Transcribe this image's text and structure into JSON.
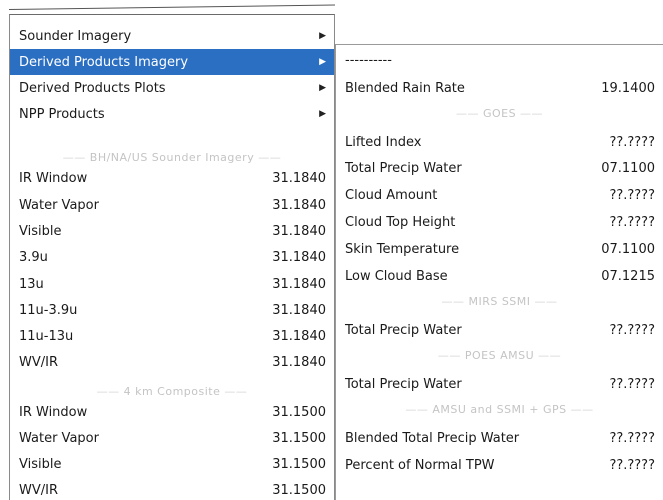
{
  "left_menu": {
    "top_items": [
      {
        "label": "Sounder Imagery"
      },
      {
        "label": "Derived Products Imagery"
      },
      {
        "label": "Derived Products Plots"
      },
      {
        "label": "NPP Products"
      }
    ],
    "separator_1": "BH/NA/US Sounder Imagery",
    "group_1": [
      {
        "label": "IR Window",
        "value": "31.1840"
      },
      {
        "label": "Water Vapor",
        "value": "31.1840"
      },
      {
        "label": "Visible",
        "value": "31.1840"
      },
      {
        "label": "3.9u",
        "value": "31.1840"
      },
      {
        "label": "13u",
        "value": "31.1840"
      },
      {
        "label": "11u-3.9u",
        "value": "31.1840"
      },
      {
        "label": "11u-13u",
        "value": "31.1840"
      },
      {
        "label": "WV/IR",
        "value": "31.1840"
      }
    ],
    "separator_2": "4 km Composite",
    "group_2": [
      {
        "label": "IR Window",
        "value": "31.1500"
      },
      {
        "label": "Water Vapor",
        "value": "31.1500"
      },
      {
        "label": "Visible",
        "value": "31.1500"
      },
      {
        "label": "WV/IR",
        "value": "31.1500"
      }
    ]
  },
  "right_menu": {
    "tearoff": "----------",
    "blended_rain": {
      "label": "Blended Rain Rate",
      "value": "19.1400"
    },
    "separator_goes": "GOES",
    "goes_items": [
      {
        "label": "Lifted Index",
        "value": "??.????"
      },
      {
        "label": "Total Precip Water",
        "value": "07.1100"
      },
      {
        "label": "Cloud Amount",
        "value": "??.????"
      },
      {
        "label": "Cloud Top Height",
        "value": "??.????"
      },
      {
        "label": "Skin Temperature",
        "value": "07.1100"
      },
      {
        "label": "Low Cloud Base",
        "value": "07.1215"
      }
    ],
    "separator_mirs": "MIRS SSMI",
    "mirs_items": [
      {
        "label": "Total Precip Water",
        "value": "??.????"
      }
    ],
    "separator_poes": "POES AMSU",
    "poes_items": [
      {
        "label": "Total Precip Water",
        "value": "??.????"
      }
    ],
    "separator_amsu": "AMSU and SSMI + GPS",
    "amsu_items": [
      {
        "label": "Blended Total Precip Water",
        "value": "??.????"
      },
      {
        "label": "Percent of Normal TPW",
        "value": "??.????"
      }
    ]
  },
  "icons": {
    "submenu": "arrow-right-icon"
  },
  "colors": {
    "highlight": "#2b6fc3"
  }
}
